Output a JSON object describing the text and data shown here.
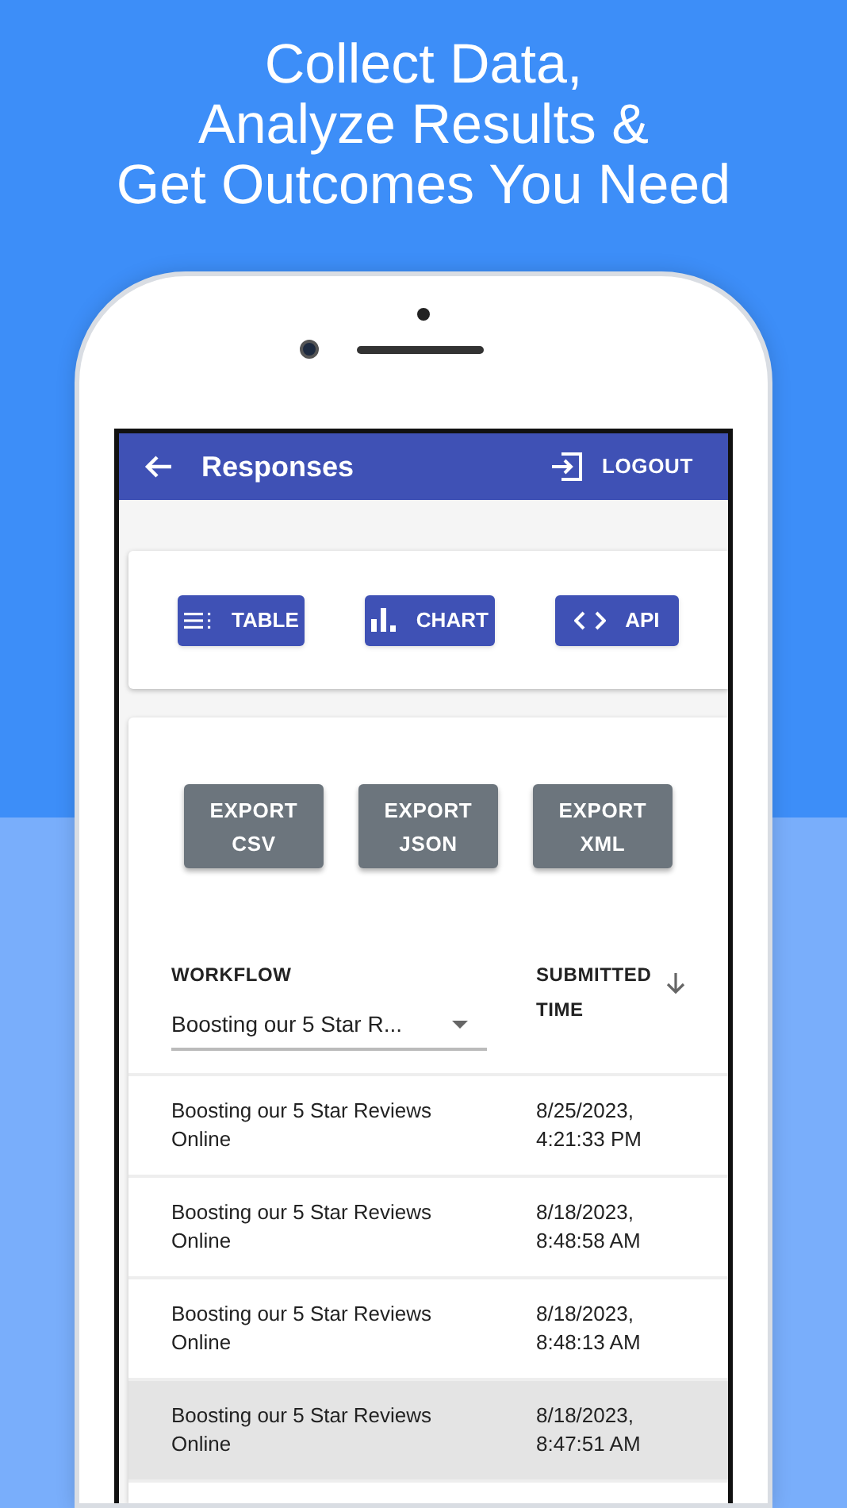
{
  "headline": [
    "Collect Data,",
    "Analyze Results &",
    "Get Outcomes You Need"
  ],
  "header": {
    "title": "Responses",
    "logout": "LOGOUT"
  },
  "view_buttons": [
    {
      "label": "TABLE",
      "kind": "table"
    },
    {
      "label": "CHART",
      "kind": "chart"
    },
    {
      "label": "API",
      "kind": "api"
    }
  ],
  "export_buttons": [
    "EXPORT CSV",
    "EXPORT JSON",
    "EXPORT XML"
  ],
  "table": {
    "columns": [
      {
        "label": "WORKFLOW"
      },
      {
        "label": "SUBMITTED TIME",
        "sorted": true
      }
    ],
    "filter": {
      "value": "Boosting our 5 Star R..."
    },
    "rows": [
      {
        "workflow": "Boosting our 5 Star Reviews Online",
        "submitted": "8/25/2023, 4:21:33 PM",
        "selected": false
      },
      {
        "workflow": "Boosting our 5 Star Reviews Online",
        "submitted": "8/18/2023, 8:48:58 AM",
        "selected": false
      },
      {
        "workflow": "Boosting our 5 Star Reviews Online",
        "submitted": "8/18/2023, 8:48:13 AM",
        "selected": false
      },
      {
        "workflow": "Boosting our 5 Star Reviews Online",
        "submitted": "8/18/2023, 8:47:51 AM",
        "selected": true
      }
    ]
  }
}
